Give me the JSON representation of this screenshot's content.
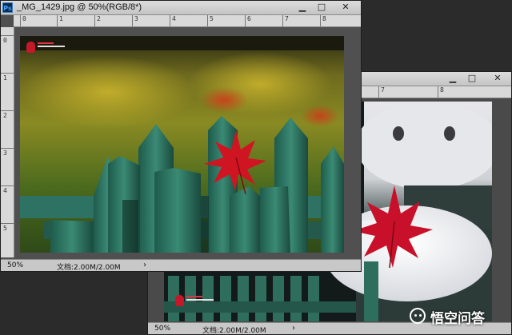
{
  "app": {
    "icon": "photoshop-icon",
    "icon_text": "Ps"
  },
  "front_window": {
    "title": "_MG_1429.jpg @ 50%(RGB/8*)",
    "ruler_top": [
      "0",
      "1",
      "2",
      "3",
      "4",
      "5",
      "6",
      "7",
      "8"
    ],
    "ruler_left": [
      "0",
      "1",
      "2",
      "3",
      "4",
      "5"
    ],
    "zoom": "50%",
    "doc_info": "文档:2.00M/2.00M",
    "status_arrow": "›"
  },
  "back_window": {
    "ruler_top": [
      "7",
      "8"
    ],
    "zoom": "50%",
    "doc_info": "文档:2.00M/2.00M",
    "status_arrow": "›"
  },
  "controls": {
    "minimize": "▁",
    "maximize": "□",
    "close": "✕"
  },
  "colors": {
    "fence_green": "#2f7a66",
    "leaf_red": "#c9121c",
    "window_chrome": "#d4d4d4",
    "backdrop": "#2b2b2b"
  },
  "overlay_brand": {
    "text": "悟空问答",
    "icon": "wukong-icon"
  }
}
